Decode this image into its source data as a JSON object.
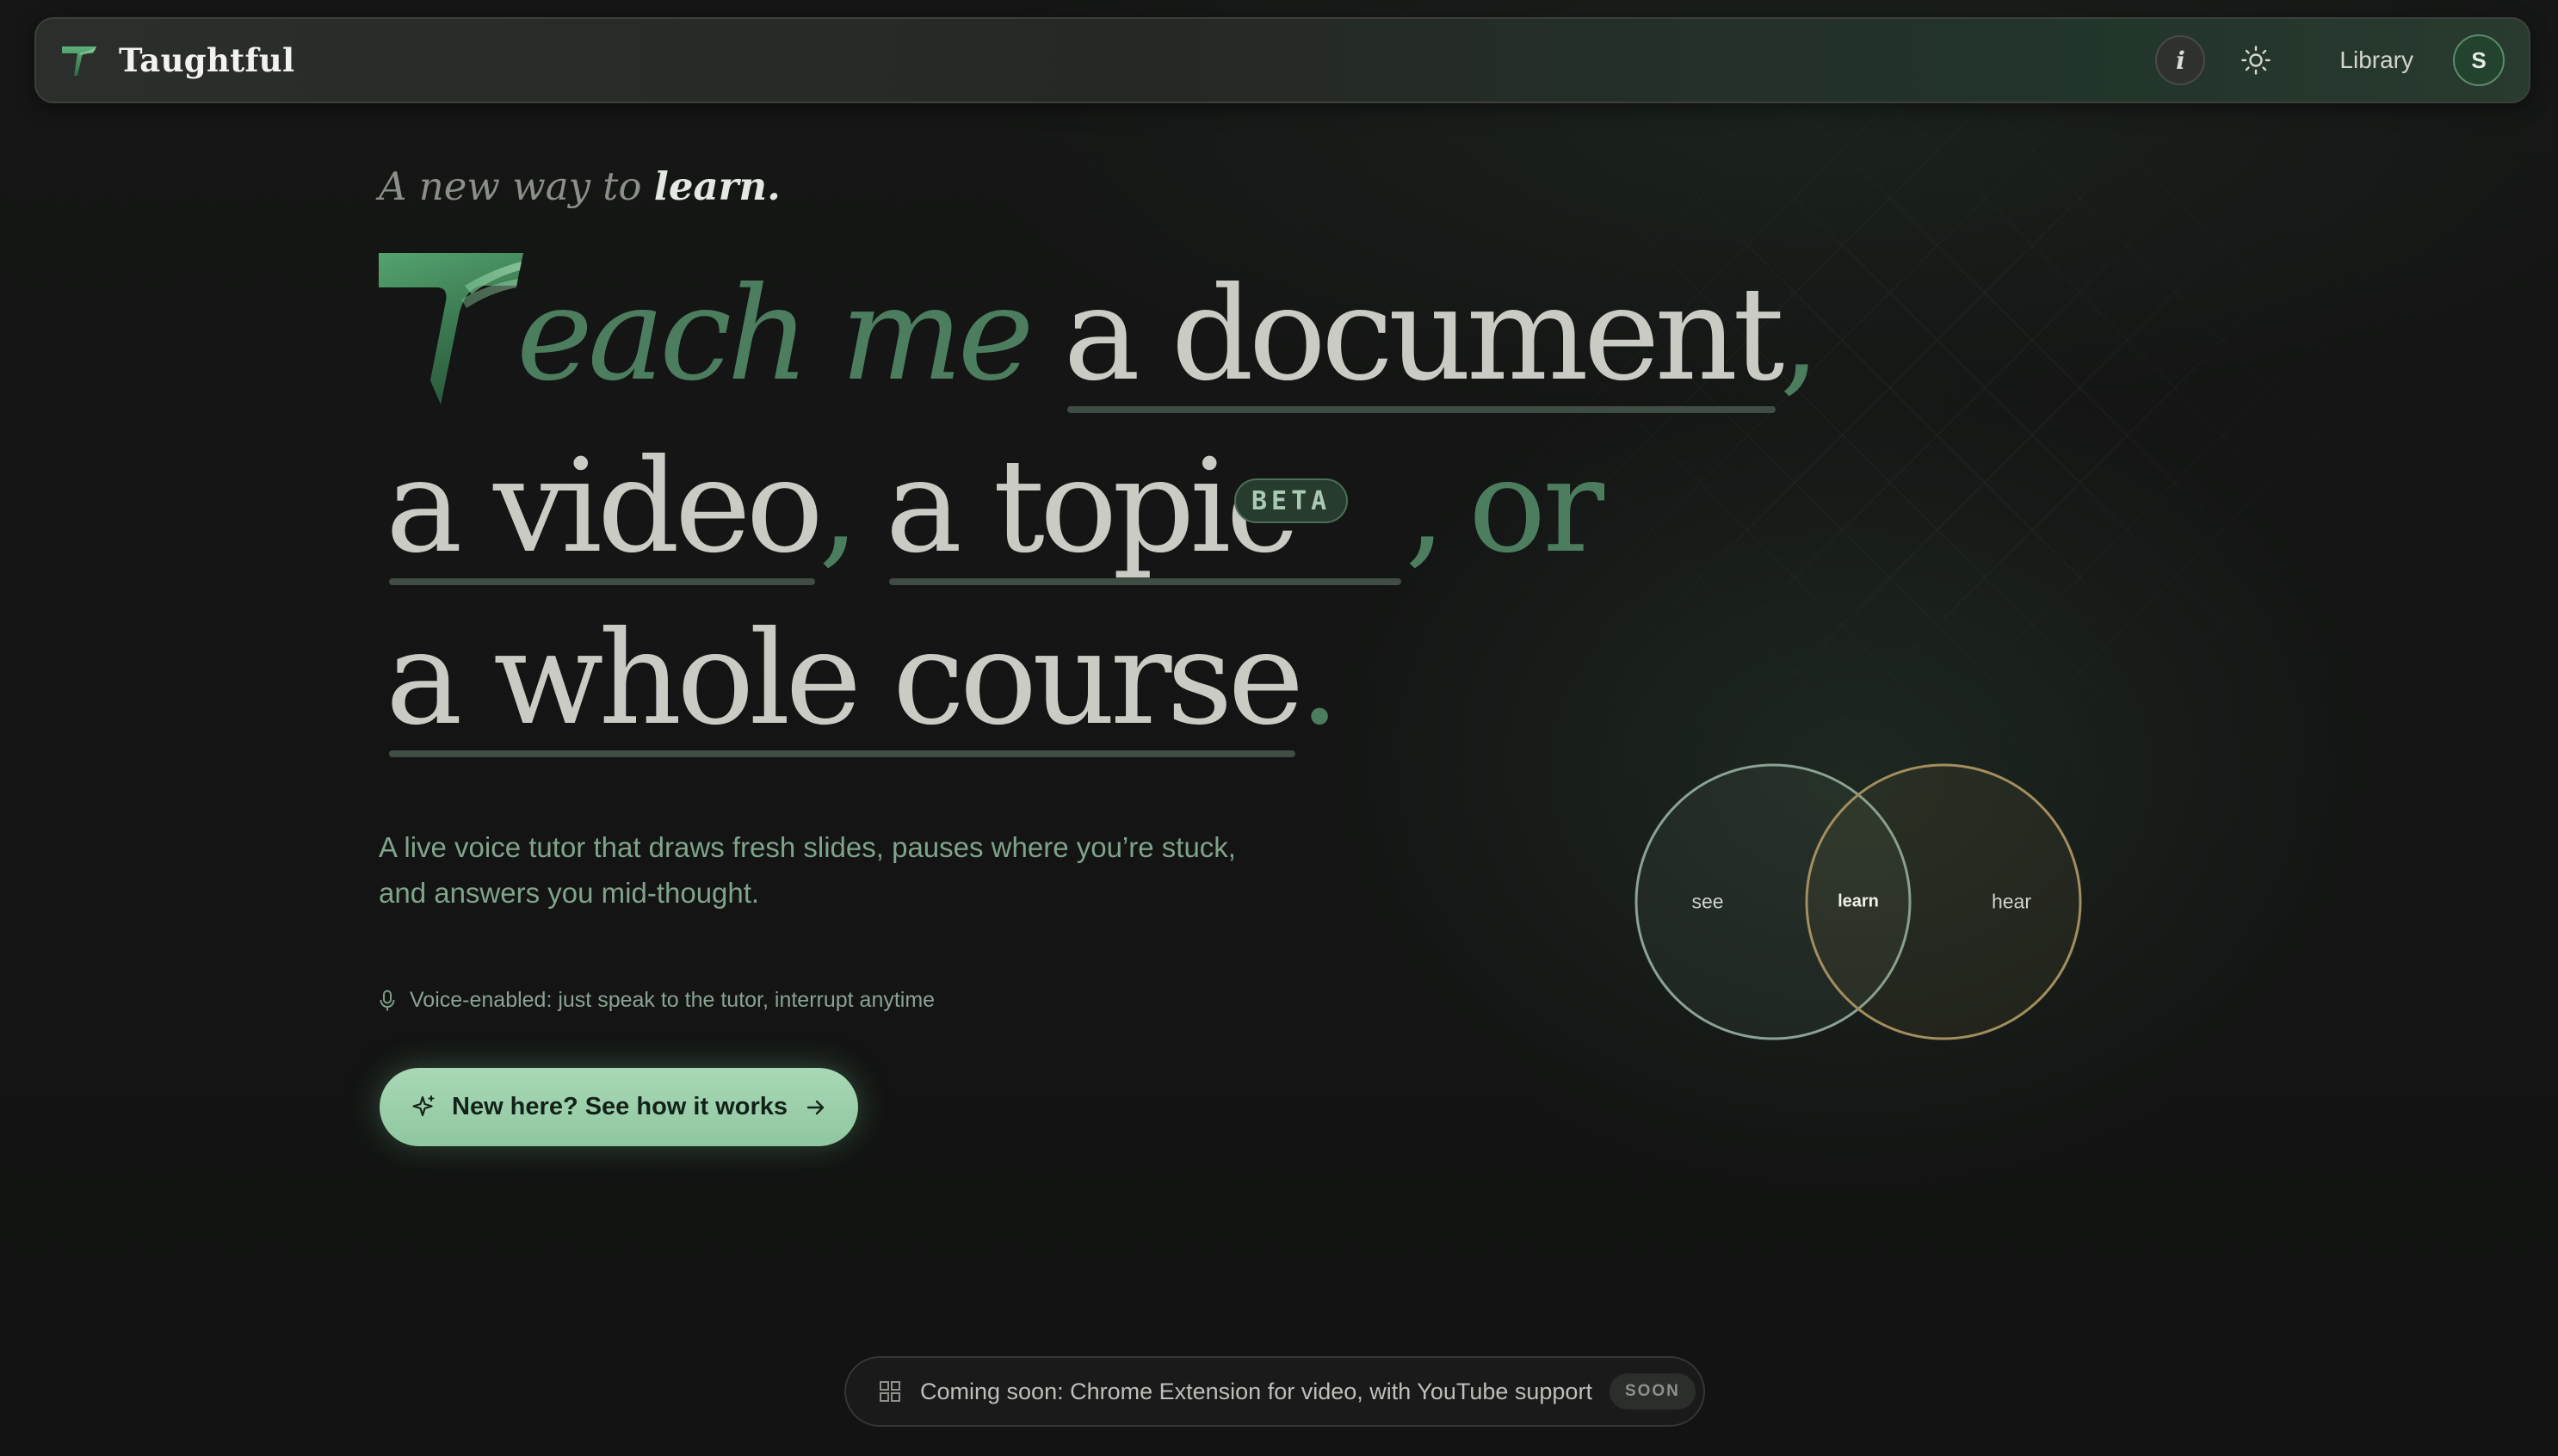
{
  "app": {
    "name": "Taughtful"
  },
  "nav": {
    "info_label": "i",
    "library_label": "Library",
    "avatar_initial": "S",
    "icons": [
      "taughtful-logo-icon",
      "info-icon",
      "sun-icon"
    ]
  },
  "hero": {
    "tagline_prefix": "A new way to ",
    "tagline_emphasis": "learn.",
    "teach_rest": "each me",
    "words": {
      "document": "a document",
      "video": "a video",
      "topic": "a topic",
      "course": "a whole course"
    },
    "separators": {
      "comma": ",",
      "or": "or",
      "period": "."
    },
    "beta_badge": "BETA",
    "subcopy_line1": "A live voice tutor that draws fresh slides, pauses where you’re stuck,",
    "subcopy_line2": "and answers you mid-thought.",
    "voice_note": "Voice-enabled: just speak to the tutor, interrupt anytime",
    "cta_label": "New here? See how it works"
  },
  "venn": {
    "left": "see",
    "center": "learn",
    "right": "hear"
  },
  "banner": {
    "text": "Coming soon: Chrome Extension for video, with YouTube support",
    "badge": "SOON"
  },
  "colors": {
    "background": "#121312",
    "accent_green": "#4b7d5e",
    "cta_green": "#a9d8b6",
    "venn_gold": "#a08a5c"
  }
}
